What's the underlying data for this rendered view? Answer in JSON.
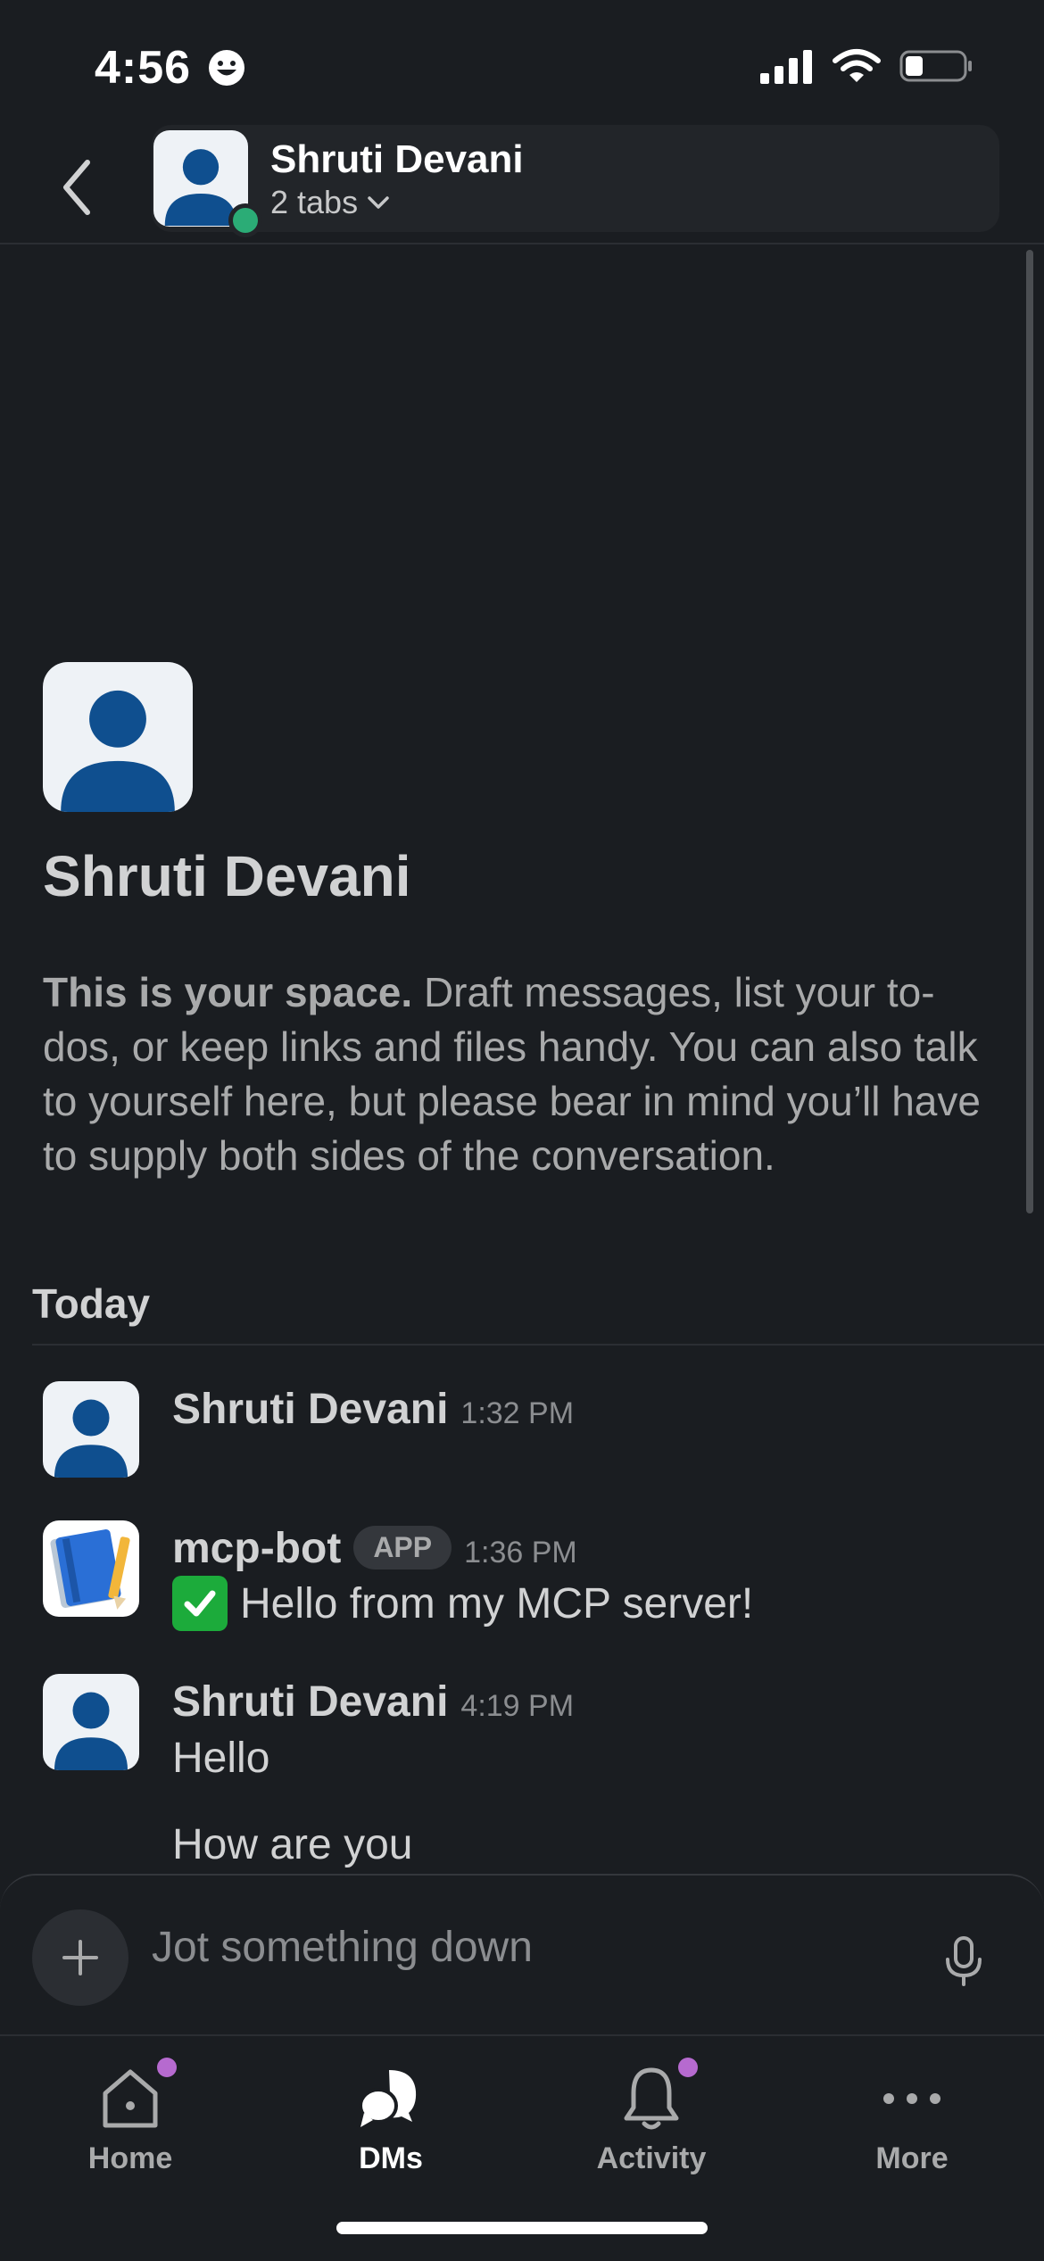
{
  "status_bar": {
    "time": "4:56",
    "emoji_icon": "smiley-face-icon",
    "battery_level": 0.3
  },
  "header": {
    "back_icon": "chevron-left-icon",
    "name": "Shruti Devani",
    "tabs_label": "2 tabs",
    "presence_color": "#2bac76"
  },
  "intro": {
    "name": "Shruti Devani",
    "desc_bold": "This is your space.",
    "desc_rest": " Draft messages, list your to-dos, or keep links and files handy. You can also talk to yourself here, but please bear in mind you’ll have to supply both sides of the conversation."
  },
  "day_divider": "Today",
  "messages": [
    {
      "sender": "Shruti Devani",
      "time": "1:32 PM",
      "avatar_icon": "user-avatar-icon"
    },
    {
      "sender": "mcp-bot",
      "badge": "APP",
      "time": "1:36 PM",
      "avatar_icon": "notebook-app-icon",
      "emoji_icon": "white-check-mark-icon",
      "text": "Hello from my MCP server!"
    },
    {
      "sender": "Shruti Devani",
      "time": "4:19 PM",
      "avatar_icon": "user-avatar-icon",
      "lines": [
        "Hello",
        "How are you"
      ]
    }
  ],
  "composer": {
    "placeholder": "Jot something down",
    "add_icon": "plus-icon",
    "mic_icon": "microphone-icon"
  },
  "tabbar": {
    "items": [
      {
        "label": "Home",
        "icon": "home-icon",
        "has_badge": true
      },
      {
        "label": "DMs",
        "icon": "dms-icon",
        "active": true
      },
      {
        "label": "Activity",
        "icon": "bell-icon",
        "has_badge": true
      },
      {
        "label": "More",
        "icon": "more-dots-icon"
      }
    ]
  },
  "colors": {
    "background": "#1a1d21",
    "badge_purple": "#b66acf",
    "avatar_blue": "#0f4f8f"
  }
}
